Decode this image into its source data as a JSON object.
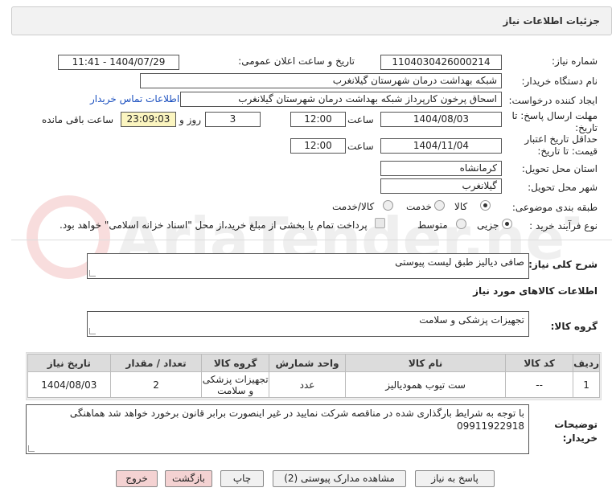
{
  "header": {
    "title": "جزئیات اطلاعات نیاز"
  },
  "fields": {
    "need_number": {
      "label": "شماره نیاز:",
      "value": "1104030426000214"
    },
    "announce_datetime": {
      "label": "تاریخ و ساعت اعلان عمومی:",
      "value": "1404/07/29 - 11:41"
    },
    "buyer_org": {
      "label": "نام دستگاه خریدار:",
      "value": "شبکه بهداشت درمان شهرستان گیلانغرب"
    },
    "requester": {
      "label": "ایجاد کننده درخواست:",
      "value": "اسحاق پرخون کارپرداز شبکه بهداشت درمان شهرستان گیلانغرب"
    },
    "contact_link": "اطلاعات تماس خریدار",
    "deadline": {
      "label": "مهلت ارسال پاسخ: تا تاریخ:",
      "date": "1404/08/03",
      "time_label": "ساعت",
      "time": "12:00",
      "days": "3",
      "days_label": "روز و",
      "remaining": "23:09:03",
      "remaining_label": "ساعت باقی مانده"
    },
    "validity": {
      "label": "حداقل تاریخ اعتبار قیمت: تا تاریخ:",
      "date": "1404/11/04",
      "time_label": "ساعت",
      "time": "12:00"
    },
    "province": {
      "label": "استان محل تحویل:",
      "value": "کرمانشاه"
    },
    "city": {
      "label": "شهر محل تحویل:",
      "value": "گیلانغرب"
    },
    "category": {
      "label": "طبقه بندی موضوعی:",
      "options": [
        "کالا",
        "خدمت",
        "کالا/خدمت"
      ],
      "selected": "کالا"
    },
    "process": {
      "label": "نوع فرآیند خرید :",
      "options": [
        "جزیی",
        "متوسط"
      ],
      "selected": "جزیی",
      "treasury_note": "پرداخت تمام یا بخشی از مبلغ خرید،از محل \"اسناد خزانه اسلامی\" خواهد بود."
    }
  },
  "description": {
    "label": "شرح کلی نیاز:",
    "value": "صافی دیالیز طبق لیست پیوستی"
  },
  "goods_info": {
    "title": "اطلاعات کالاهای مورد نیاز"
  },
  "goods_group": {
    "label": "گروه کالا:",
    "value": "تجهیزات پزشکی و سلامت"
  },
  "table": {
    "headers": [
      "ردیف",
      "کد کالا",
      "نام کالا",
      "واحد شمارش",
      "گروه کالا",
      "تعداد / مقدار",
      "تاریخ نیاز"
    ],
    "rows": [
      [
        "1",
        "--",
        "ست تیوب همودیالیز",
        "عدد",
        "تجهیزات پزشکی و سلامت",
        "2",
        "1404/08/03"
      ]
    ]
  },
  "buyer_notes": {
    "label": "توضیحات خریدار:",
    "value": "با توجه به شرایط بارگذاری شده در مناقصه شرکت نمایید در غیر اینصورت برابر قانون برخورد خواهد شد هماهنگی 09911922918"
  },
  "buttons": {
    "reply": "پاسخ به نیاز",
    "docs": "مشاهده مدارک پیوستی (2)",
    "print": "چاپ",
    "back": "بازگشت",
    "exit": "خروج"
  },
  "watermark_text": "AriaTender.neT",
  "colors": {
    "accent_link": "#1a4fbf",
    "remaining_bg": "#fbf5c0",
    "danger_btn": "#f4d2d2"
  }
}
